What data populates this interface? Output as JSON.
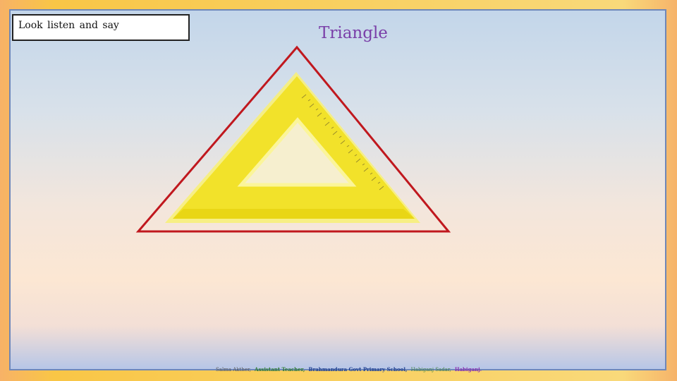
{
  "slide": {
    "instruction": "Look listen and say",
    "title": "Triangle",
    "footer": {
      "name": "Salma Akther,",
      "role": "Assistant Teacher,",
      "school": "Brahmandura Govt Primary School,",
      "upazila": "Habiganj Sadar,",
      "district": "Habiganj."
    }
  },
  "colors": {
    "title": "#7a3fa8",
    "triangle_outline": "#c0181e",
    "set_square_fill": "#f2e22a",
    "set_square_edge": "#fff06a"
  },
  "icons": {
    "set_square": "set-square-ruler-icon",
    "triangle": "triangle-outline-icon"
  }
}
